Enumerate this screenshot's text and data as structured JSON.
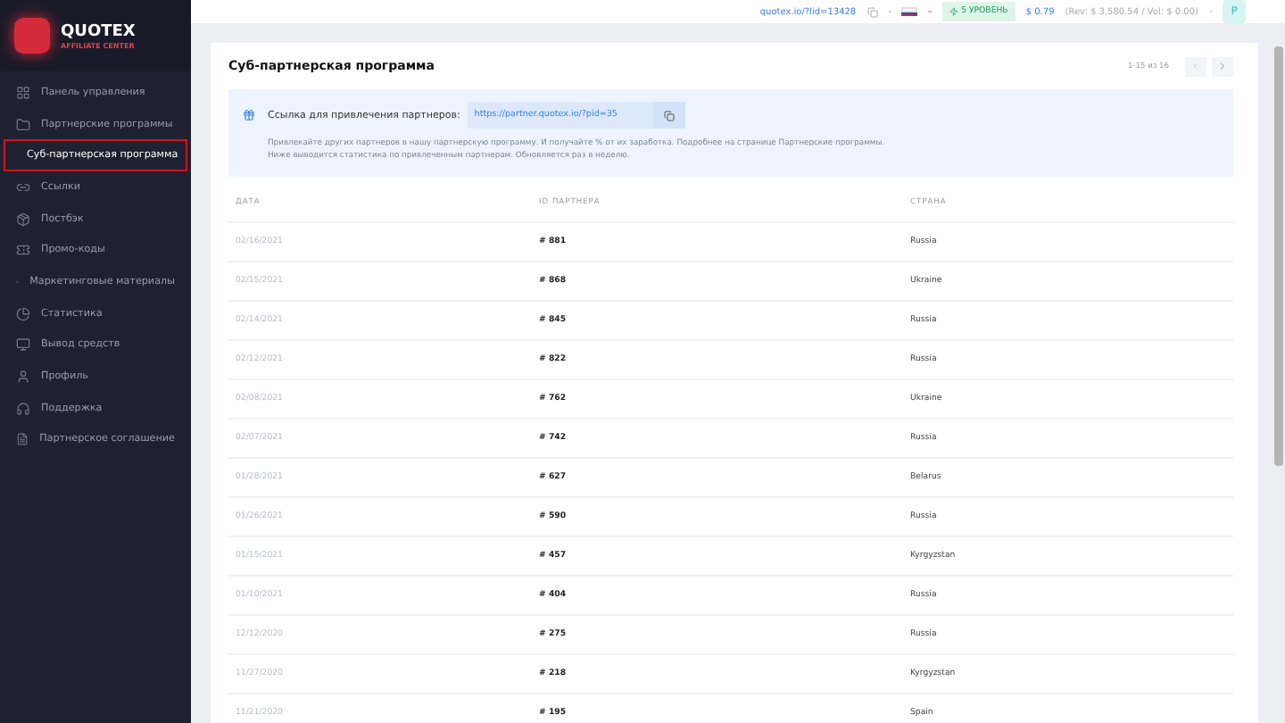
{
  "brand": {
    "name": "QUOTEX",
    "subtitle": "AFFILIATE CENTER"
  },
  "sidebar": {
    "items": [
      {
        "label": "Панель управления",
        "selected": false
      },
      {
        "label": "Партнерские программы",
        "selected": false
      },
      {
        "label": "Суб-партнерская программа",
        "selected": true
      },
      {
        "label": "Ссылки",
        "selected": false
      },
      {
        "label": "Постбэк",
        "selected": false
      },
      {
        "label": "Промо-коды",
        "selected": false
      },
      {
        "label": "Маркетинговые материалы",
        "selected": false
      },
      {
        "label": "Статистика",
        "selected": false
      },
      {
        "label": "Вывод средств",
        "selected": false
      },
      {
        "label": "Профиль",
        "selected": false
      },
      {
        "label": "Поддержка",
        "selected": false
      },
      {
        "label": "Партнерское соглашение",
        "selected": false
      }
    ]
  },
  "header": {
    "link": "quotex.io/?lid=13428",
    "level": "5 УРОВЕНЬ",
    "balance": "$ 0.79",
    "stats": "(Rev: $ 3,580.54 / Vol: $ 0.00)",
    "avatar": "P"
  },
  "page": {
    "title": "Суб-партнерская программа",
    "pagination": "1-15 из 16",
    "prev_disabled": true,
    "referral": {
      "label": "Ссылка для привлечения партнеров:",
      "url": "https://partner.quotex.io/?pid=35"
    },
    "info": [
      "Привлекайте других партнеров в нашу партнерскую программу. И получайте % от их заработка. Подробнее на странице Партнерские программы.",
      "Ниже выводится статистика по привлеченным партнерам. Обновляется раз в неделю."
    ]
  },
  "table": {
    "columns": [
      "ДАТА",
      "ID ПАРТНЕРА",
      "СТРАНА"
    ],
    "rows": [
      [
        "02/16/2021",
        "# 881",
        "Russia"
      ],
      [
        "02/15/2021",
        "# 868",
        "Ukraine"
      ],
      [
        "02/14/2021",
        "# 845",
        "Russia"
      ],
      [
        "02/12/2021",
        "# 822",
        "Russia"
      ],
      [
        "02/08/2021",
        "# 762",
        "Ukraine"
      ],
      [
        "02/07/2021",
        "# 742",
        "Russia"
      ],
      [
        "01/28/2021",
        "# 627",
        "Belarus"
      ],
      [
        "01/26/2021",
        "# 590",
        "Russia"
      ],
      [
        "01/15/2021",
        "# 457",
        "Kyrgyzstan"
      ],
      [
        "01/10/2021",
        "# 404",
        "Russia"
      ],
      [
        "12/12/2020",
        "# 275",
        "Russia"
      ],
      [
        "11/27/2020",
        "# 218",
        "Kyrgyzstan"
      ],
      [
        "11/21/2020",
        "# 195",
        "Spain"
      ]
    ]
  }
}
